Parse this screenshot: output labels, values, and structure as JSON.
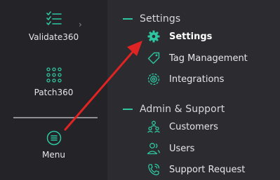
{
  "sidebar": {
    "items": [
      {
        "label": "Validate360",
        "icon": "checklist-icon"
      },
      {
        "label": "Patch360",
        "icon": "dot-grid-icon"
      },
      {
        "label": "Menu",
        "icon": "menu-circle-icon"
      }
    ]
  },
  "panel": {
    "sections": [
      {
        "title": "Settings",
        "items": [
          {
            "label": "Settings",
            "icon": "gear-icon",
            "active": true
          },
          {
            "label": "Tag Management",
            "icon": "tag-icon"
          },
          {
            "label": "Integrations",
            "icon": "integrations-icon"
          }
        ]
      },
      {
        "title": "Admin & Support",
        "items": [
          {
            "label": "Customers",
            "icon": "customers-icon"
          },
          {
            "label": "Users",
            "icon": "users-icon"
          },
          {
            "label": "Support Request",
            "icon": "support-request-icon"
          }
        ]
      }
    ]
  },
  "colors": {
    "accent": "#2ec6a0",
    "annotation_arrow": "#e02424"
  }
}
